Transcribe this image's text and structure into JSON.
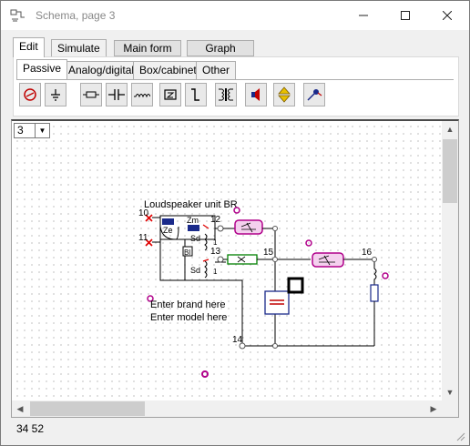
{
  "window": {
    "title": "Schema, page 3",
    "minimize_icon": "minimize-icon",
    "maximize_icon": "maximize-icon",
    "close_icon": "close-icon"
  },
  "top_tabs": [
    {
      "label": "Edit",
      "active": true
    },
    {
      "label": "Simulate",
      "active": false
    }
  ],
  "form_buttons": {
    "main_form": "Main form",
    "graph": "Graph"
  },
  "sub_tabs": [
    {
      "label": "Passive",
      "active": true
    },
    {
      "label": "Analog/digital",
      "active": false
    },
    {
      "label": "Box/cabinet",
      "active": false
    },
    {
      "label": "Other",
      "active": false
    }
  ],
  "tools": [
    "generator-icon",
    "ground-icon",
    "resistor-icon",
    "capacitor-icon",
    "inductor-icon",
    "impedance-icon",
    "switch-icon",
    "transformer-icon",
    "speaker-icon",
    "updown-arrow-icon",
    "probe-icon"
  ],
  "page_select": {
    "value": "3"
  },
  "schematic": {
    "title": "Loudspeaker unit BR",
    "labels": {
      "ze": "Ze",
      "zm": "Zm",
      "sd1": "Sd",
      "sd2": "Sd",
      "bl": "Bl",
      "one1": "1",
      "one2": "1"
    },
    "nodes": [
      "10",
      "11",
      "12",
      "13",
      "14",
      "15",
      "16"
    ],
    "brand_placeholder": "Enter brand here",
    "model_placeholder": "Enter model here"
  },
  "status": {
    "text": "34  52"
  },
  "colors": {
    "accent_magenta": "#b0008a",
    "error_red": "#e00000",
    "chip_green": "#008000",
    "chip_blue": "#1a2a8a"
  }
}
